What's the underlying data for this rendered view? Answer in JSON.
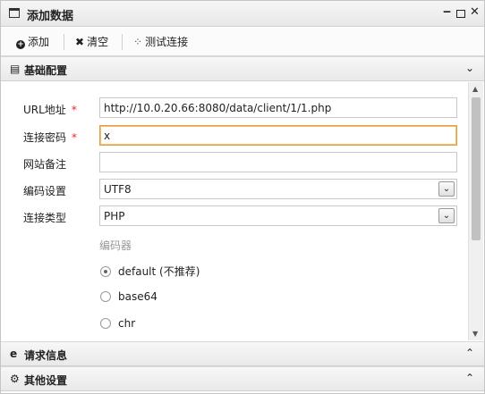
{
  "window": {
    "title": "添加数据",
    "icon": "window-icon",
    "controls": {
      "minimize": "‒",
      "close": "✕"
    }
  },
  "toolbar": {
    "add": {
      "icon": "plus-circle-icon",
      "label": "添加"
    },
    "clear": {
      "icon": "x-icon",
      "label": "清空"
    },
    "test": {
      "icon": "spinner-icon",
      "label": "测试连接"
    }
  },
  "sections": {
    "basic": {
      "icon": "document-icon",
      "label": "基础配置",
      "chevron": "chevron-down-icon"
    },
    "request": {
      "icon": "e-icon",
      "label": "请求信息",
      "chevron": "chevron-up-icon"
    },
    "other": {
      "icon": "gears-icon",
      "label": "其他设置",
      "chevron": "chevron-up-icon"
    }
  },
  "form": {
    "url": {
      "label": "URL地址",
      "required": "*",
      "value": "http://10.0.20.66:8080/data/client/1/1.php"
    },
    "password": {
      "label": "连接密码",
      "required": "*",
      "value": "x"
    },
    "note": {
      "label": "网站备注",
      "value": ""
    },
    "encoding": {
      "label": "编码设置",
      "selected": "UTF8"
    },
    "type": {
      "label": "连接类型",
      "selected": "PHP"
    },
    "encoder": {
      "label": "编码器",
      "options": [
        {
          "label": "default (不推荐)",
          "checked": true
        },
        {
          "label": "base64",
          "checked": false
        },
        {
          "label": "chr",
          "checked": false
        }
      ]
    }
  },
  "colors": {
    "required": "#ee2233",
    "focus_border": "#e0a040"
  }
}
